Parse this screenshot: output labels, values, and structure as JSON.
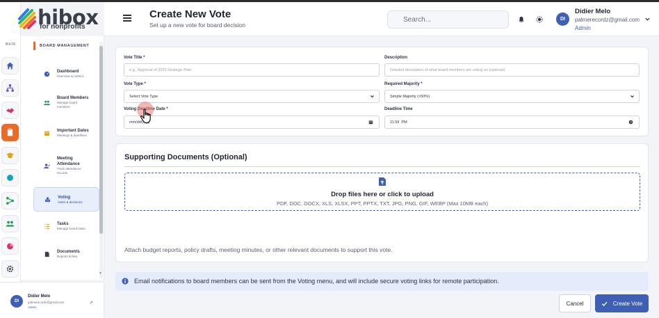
{
  "brand": {
    "name": "hibox",
    "tagline": "for nonprofits"
  },
  "rail": {
    "label": "MAIN"
  },
  "sidebar": {
    "section": "BOARD MANAGEMENT",
    "items": [
      {
        "title": "Dashboard",
        "sub": "Overview & metrics",
        "icon": "dashboard-icon"
      },
      {
        "title": "Board Members",
        "sub": "Manage board members",
        "icon": "users-icon"
      },
      {
        "title": "Important Dates",
        "sub": "Meetings & deadlines",
        "icon": "calendar-icon"
      },
      {
        "title": "Meeting Attendance",
        "sub": "Track attendance records",
        "icon": "attendance-icon"
      },
      {
        "title": "Voting",
        "sub": "Votes & decisions",
        "icon": "vote-icon"
      },
      {
        "title": "Tasks",
        "sub": "Manage board tasks",
        "icon": "tasks-icon"
      },
      {
        "title": "Documents",
        "sub": "Reports & files",
        "icon": "document-icon"
      }
    ],
    "user": {
      "name": "Didier Melo",
      "email": "palmerecordz@gmail.com",
      "role": "Admin",
      "initials": "DI"
    }
  },
  "header": {
    "title": "Create New Vote",
    "subtitle": "Set up a new vote for board decision",
    "search_placeholder": "Search...",
    "user": {
      "name": "Didier Melo",
      "email": "palmerecordz@gmail.com",
      "role": "Admin",
      "initials": "DI"
    }
  },
  "form": {
    "vote_title": {
      "label": "Vote Title *",
      "placeholder": "e.g., Approval of 2025 Strategic Plan"
    },
    "description": {
      "label": "Description",
      "placeholder": "Detailed description of what board members are voting on (optional)"
    },
    "vote_type": {
      "label": "Vote Type *",
      "value": "Select Vote Type"
    },
    "required_majority": {
      "label": "Required Majority *",
      "value": "Simple Majority (>50%)"
    },
    "deadline_date": {
      "label": "Voting Deadline Date *",
      "value": "mm/dd/yyyy"
    },
    "deadline_time": {
      "label": "Deadline Time",
      "value": "11:59  PM"
    }
  },
  "documents": {
    "title": "Supporting Documents (Optional)",
    "drop_title": "Drop files here or click to upload",
    "drop_sub": "PDF, DOC, DOCX, XLS, XLSX, PPT, PPTX, TXT, JPG, PNG, GIF, WEBP (Max 10MB each)",
    "help": "Attach budget reports, policy drafts, meeting minutes, or other relevant documents to support this vote."
  },
  "info": {
    "text": "Email notifications to board members can be sent from the Voting menu, and will include secure voting links for remote participation."
  },
  "actions": {
    "cancel": "Cancel",
    "create": "Create Vote"
  },
  "colors": {
    "accent": "#ea6a2a",
    "primary": "#3e5fb3",
    "info_bg": "#e4ebfa"
  }
}
